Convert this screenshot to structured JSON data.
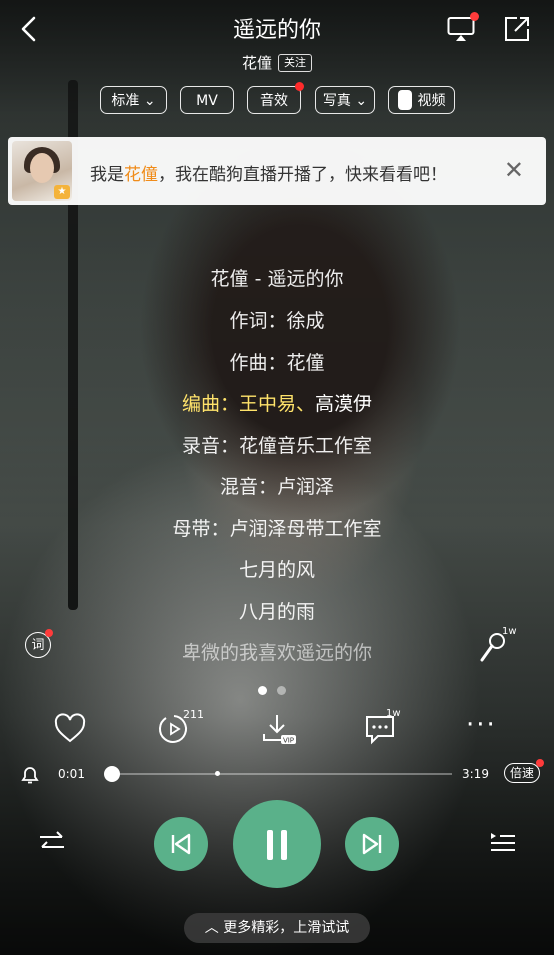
{
  "header": {
    "title": "遥远的你",
    "artist": "花僮",
    "follow_label": "关注"
  },
  "chips": {
    "quality": "标准",
    "mv": "MV",
    "effect": "音效",
    "photo": "写真",
    "video": "视频"
  },
  "banner": {
    "prefix": "我是",
    "name": "花僮",
    "suffix": "，我在酷狗直播开播了，快来看看吧！",
    "close": "✕"
  },
  "lyrics": {
    "l0": "花僮 - 遥远的你",
    "l1": "作词：徐成",
    "l2": "作曲：花僮",
    "l3_hl": "编曲：王中易、",
    "l3_rest": "高漠伊",
    "l4": "录音：花僮音乐工作室",
    "l5": "混音：卢润泽",
    "l6": "母带：卢润泽母带工作室",
    "l7": "七月的风",
    "l8": "八月的雨",
    "l9": "卑微的我喜欢遥远的你"
  },
  "side": {
    "ci": "词",
    "mic_count": "1w"
  },
  "actions": {
    "comment_count": "1w",
    "play_count": "211"
  },
  "progress": {
    "current": "0:01",
    "total": "3:19",
    "fraction": 0.005,
    "speed": "倍速"
  },
  "footer": {
    "more": "更多精彩，上滑试试"
  },
  "colors": {
    "accent": "#5ab18a",
    "highlight": "#ffe36b",
    "badge": "#ff3b3b"
  }
}
